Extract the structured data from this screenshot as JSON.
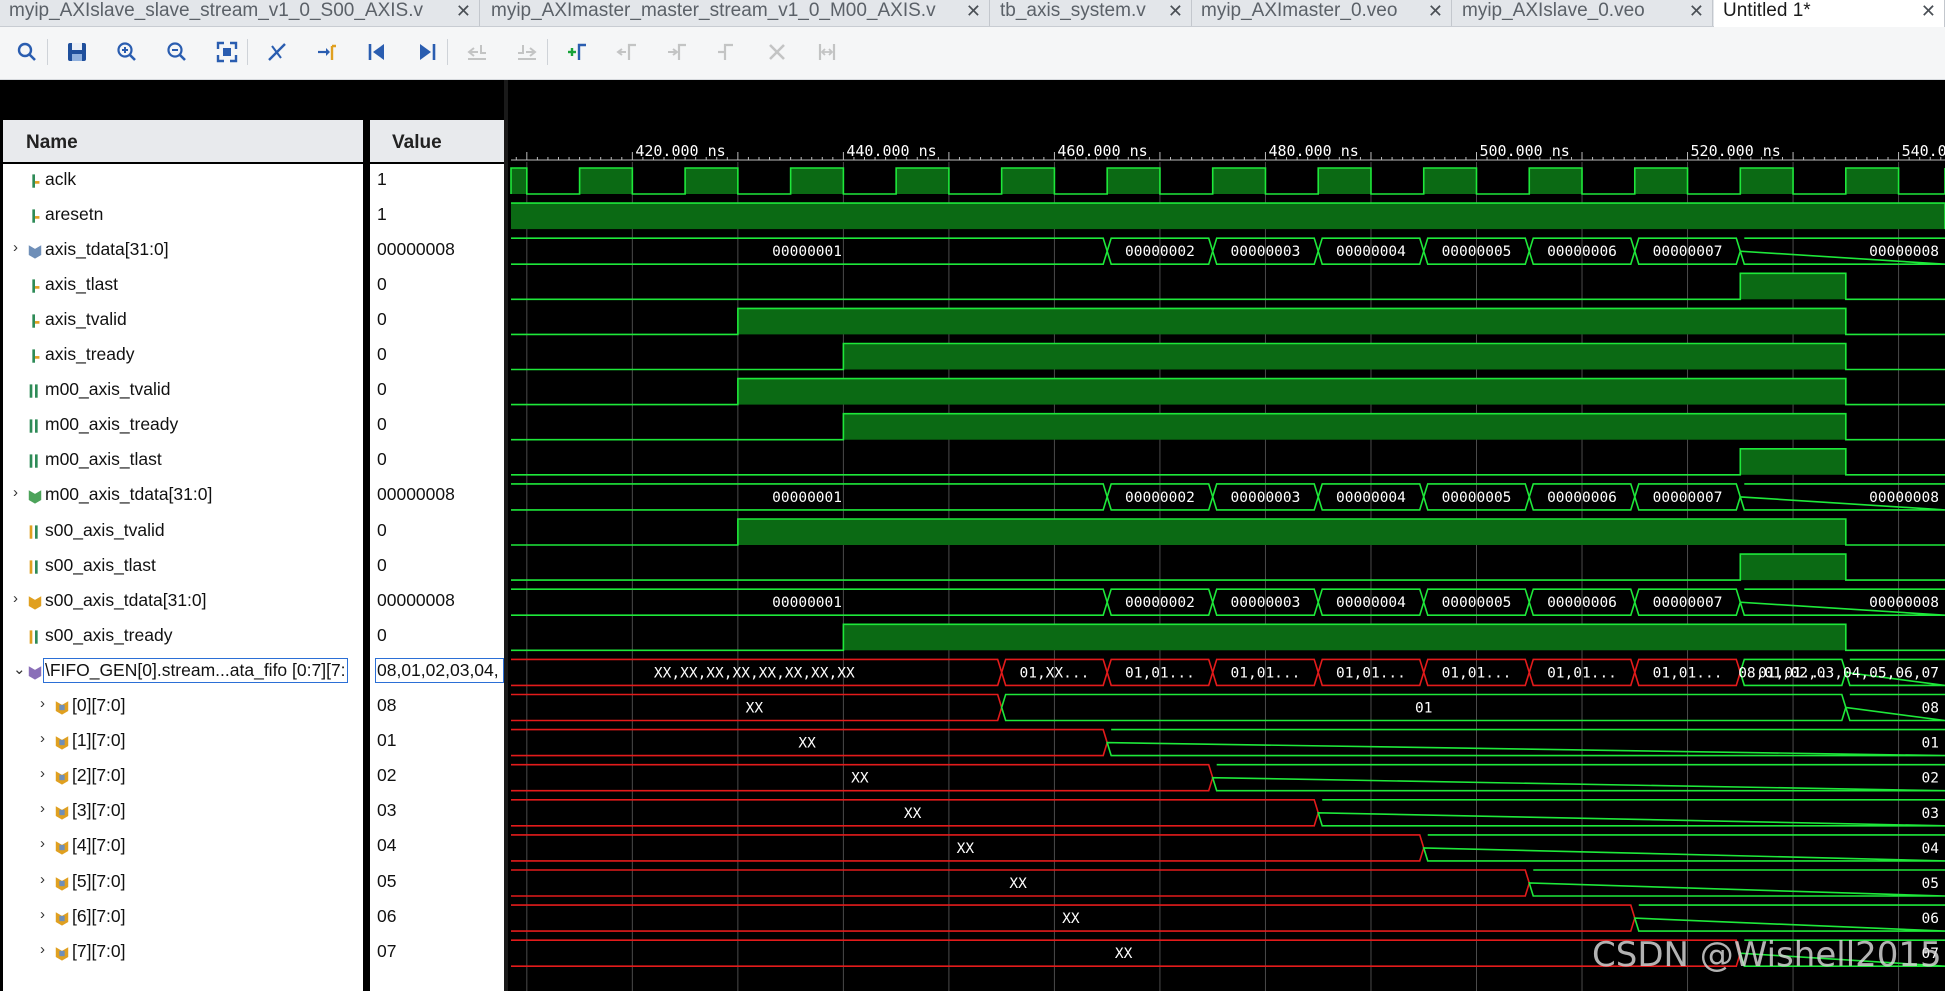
{
  "tabs": [
    {
      "label": "myip_AXIslave_slave_stream_v1_0_S00_AXIS.v",
      "active": false
    },
    {
      "label": "myip_AXImaster_master_stream_v1_0_M00_AXIS.v",
      "active": false
    },
    {
      "label": "tb_axis_system.v",
      "active": false
    },
    {
      "label": "myip_AXImaster_0.veo",
      "active": false
    },
    {
      "label": "myip_AXIslave_0.veo",
      "active": false
    },
    {
      "label": "Untitled 1*",
      "active": true
    }
  ],
  "toolbar": {
    "buttons": [
      {
        "name": "search-icon",
        "enabled": true
      },
      {
        "name": "save-icon",
        "enabled": true
      },
      {
        "name": "zoom-in-icon",
        "enabled": true
      },
      {
        "name": "zoom-out-icon",
        "enabled": true
      },
      {
        "name": "zoom-fit-icon",
        "enabled": true
      },
      {
        "name": "cursor-to-zero-icon",
        "enabled": true
      },
      {
        "name": "go-to-cursor-icon",
        "enabled": true
      },
      {
        "name": "go-to-start-icon",
        "enabled": true
      },
      {
        "name": "go-to-end-icon",
        "enabled": true
      },
      {
        "name": "previous-transition-icon",
        "enabled": false
      },
      {
        "name": "next-transition-icon",
        "enabled": false
      },
      {
        "name": "add-marker-icon",
        "enabled": true
      },
      {
        "name": "previous-marker-icon",
        "enabled": false
      },
      {
        "name": "next-marker-icon",
        "enabled": false
      },
      {
        "name": "swap-cursors-icon",
        "enabled": false
      },
      {
        "name": "delete-marker-icon",
        "enabled": false
      },
      {
        "name": "snap-to-transition-icon",
        "enabled": false
      }
    ]
  },
  "columns": {
    "name": "Name",
    "value": "Value"
  },
  "signals": [
    {
      "name": "aclk",
      "value": "1",
      "type": "bit",
      "icon": "input-bit-icon",
      "expander": ""
    },
    {
      "name": "aresetn",
      "value": "1",
      "type": "bit",
      "icon": "input-bit-icon",
      "expander": ""
    },
    {
      "name": "axis_tdata[31:0]",
      "value": "00000008",
      "type": "bus",
      "icon": "bus-icon",
      "expander": "›"
    },
    {
      "name": "axis_tlast",
      "value": "0",
      "type": "bit",
      "icon": "input-bit-icon",
      "expander": ""
    },
    {
      "name": "axis_tvalid",
      "value": "0",
      "type": "bit",
      "icon": "input-bit-icon",
      "expander": ""
    },
    {
      "name": "axis_tready",
      "value": "0",
      "type": "bit",
      "icon": "input-bit-icon",
      "expander": ""
    },
    {
      "name": "m00_axis_tvalid",
      "value": "0",
      "type": "bit",
      "icon": "output-bit-icon",
      "expander": ""
    },
    {
      "name": "m00_axis_tready",
      "value": "0",
      "type": "bit",
      "icon": "output-bit-icon",
      "expander": ""
    },
    {
      "name": "m00_axis_tlast",
      "value": "0",
      "type": "bit",
      "icon": "output-bit-icon",
      "expander": ""
    },
    {
      "name": "m00_axis_tdata[31:0]",
      "value": "00000008",
      "type": "bus",
      "icon": "output-bus-icon",
      "expander": "›"
    },
    {
      "name": "s00_axis_tvalid",
      "value": "0",
      "type": "bit",
      "icon": "internal-bit-icon",
      "expander": ""
    },
    {
      "name": "s00_axis_tlast",
      "value": "0",
      "type": "bit",
      "icon": "internal-bit-icon",
      "expander": ""
    },
    {
      "name": "s00_axis_tdata[31:0]",
      "value": "00000008",
      "type": "bus",
      "icon": "internal-bus-icon",
      "expander": "›"
    },
    {
      "name": "s00_axis_tready",
      "value": "0",
      "type": "bit",
      "icon": "internal-bit-icon",
      "expander": ""
    },
    {
      "name": "\\FIFO_GEN[0].stream...ata_fifo [0:7][7:",
      "value": "08,01,02,03,04,",
      "type": "array",
      "icon": "array-icon",
      "expander": "⌄",
      "selected": true
    },
    {
      "name": "[0][7:0]",
      "value": "08",
      "type": "bus",
      "icon": "array-bus-icon",
      "expander": "›",
      "indent": true
    },
    {
      "name": "[1][7:0]",
      "value": "01",
      "type": "bus",
      "icon": "array-bus-icon",
      "expander": "›",
      "indent": true
    },
    {
      "name": "[2][7:0]",
      "value": "02",
      "type": "bus",
      "icon": "array-bus-icon",
      "expander": "›",
      "indent": true
    },
    {
      "name": "[3][7:0]",
      "value": "03",
      "type": "bus",
      "icon": "array-bus-icon",
      "expander": "›",
      "indent": true
    },
    {
      "name": "[4][7:0]",
      "value": "04",
      "type": "bus",
      "icon": "array-bus-icon",
      "expander": "›",
      "indent": true
    },
    {
      "name": "[5][7:0]",
      "value": "05",
      "type": "bus",
      "icon": "array-bus-icon",
      "expander": "›",
      "indent": true
    },
    {
      "name": "[6][7:0]",
      "value": "06",
      "type": "bus",
      "icon": "array-bus-icon",
      "expander": "›",
      "indent": true
    },
    {
      "name": "[7][7:0]",
      "value": "07",
      "type": "bus",
      "icon": "array-bus-icon",
      "expander": "›",
      "indent": true
    }
  ],
  "timeline": {
    "unit": "ns",
    "view_start": 408.5,
    "view_end": 544.4,
    "tick_labels": [
      "420.000 ns",
      "440.000 ns",
      "460.000 ns",
      "480.000 ns",
      "500.000 ns",
      "520.000 ns",
      "540.000 ns"
    ],
    "tick_values": [
      420,
      440,
      460,
      480,
      500,
      520,
      540
    ],
    "clock_period": 10
  },
  "waveforms": [
    {
      "kind": "clock",
      "high_times": [
        [
          405,
          410
        ],
        [
          415,
          420
        ],
        [
          425,
          430
        ],
        [
          435,
          440
        ],
        [
          445,
          450
        ],
        [
          455,
          460
        ],
        [
          465,
          470
        ],
        [
          475,
          480
        ],
        [
          485,
          490
        ],
        [
          495,
          500
        ],
        [
          505,
          510
        ],
        [
          515,
          520
        ],
        [
          525,
          530
        ],
        [
          535,
          540
        ],
        [
          545,
          550
        ]
      ]
    },
    {
      "kind": "level",
      "start_value": 1,
      "edges": []
    },
    {
      "kind": "bus",
      "color": "green",
      "segments": [
        {
          "start": 400,
          "end": 465,
          "label": "00000001"
        },
        {
          "start": 465,
          "end": 475,
          "label": "00000002"
        },
        {
          "start": 475,
          "end": 485,
          "label": "00000003"
        },
        {
          "start": 485,
          "end": 495,
          "label": "00000004"
        },
        {
          "start": 495,
          "end": 505,
          "label": "00000005"
        },
        {
          "start": 505,
          "end": 515,
          "label": "00000006"
        },
        {
          "start": 515,
          "end": 525,
          "label": "00000007"
        },
        {
          "start": 525,
          "end": 600,
          "label": "00000008"
        }
      ]
    },
    {
      "kind": "level",
      "start_value": 0,
      "edges": [
        525,
        535
      ]
    },
    {
      "kind": "level",
      "start_value": 0,
      "edges": [
        430,
        535
      ]
    },
    {
      "kind": "level",
      "start_value": 0,
      "edges": [
        440,
        535
      ]
    },
    {
      "kind": "level",
      "start_value": 0,
      "edges": [
        430,
        535
      ]
    },
    {
      "kind": "level",
      "start_value": 0,
      "edges": [
        440,
        535
      ]
    },
    {
      "kind": "level",
      "start_value": 0,
      "edges": [
        525,
        535
      ]
    },
    {
      "kind": "bus",
      "color": "green",
      "segments": [
        {
          "start": 400,
          "end": 465,
          "label": "00000001"
        },
        {
          "start": 465,
          "end": 475,
          "label": "00000002"
        },
        {
          "start": 475,
          "end": 485,
          "label": "00000003"
        },
        {
          "start": 485,
          "end": 495,
          "label": "00000004"
        },
        {
          "start": 495,
          "end": 505,
          "label": "00000005"
        },
        {
          "start": 505,
          "end": 515,
          "label": "00000006"
        },
        {
          "start": 515,
          "end": 525,
          "label": "00000007"
        },
        {
          "start": 525,
          "end": 600,
          "label": "00000008"
        }
      ]
    },
    {
      "kind": "level",
      "start_value": 0,
      "edges": [
        430,
        535
      ]
    },
    {
      "kind": "level",
      "start_value": 0,
      "edges": [
        525,
        535
      ]
    },
    {
      "kind": "bus",
      "color": "green",
      "segments": [
        {
          "start": 400,
          "end": 465,
          "label": "00000001"
        },
        {
          "start": 465,
          "end": 475,
          "label": "00000002"
        },
        {
          "start": 475,
          "end": 485,
          "label": "00000003"
        },
        {
          "start": 485,
          "end": 495,
          "label": "00000004"
        },
        {
          "start": 495,
          "end": 505,
          "label": "00000005"
        },
        {
          "start": 505,
          "end": 515,
          "label": "00000006"
        },
        {
          "start": 515,
          "end": 525,
          "label": "00000007"
        },
        {
          "start": 525,
          "end": 600,
          "label": "00000008"
        }
      ]
    },
    {
      "kind": "level",
      "start_value": 0,
      "edges": [
        440,
        535
      ]
    },
    {
      "kind": "bus",
      "segments": [
        {
          "start": 400,
          "end": 455,
          "label": "XX,XX,XX,XX,XX,XX,XX,XX",
          "color": "red"
        },
        {
          "start": 455,
          "end": 465,
          "label": "01,XX...",
          "color": "red"
        },
        {
          "start": 465,
          "end": 475,
          "label": "01,01...",
          "color": "red"
        },
        {
          "start": 475,
          "end": 485,
          "label": "01,01...",
          "color": "red"
        },
        {
          "start": 485,
          "end": 495,
          "label": "01,01...",
          "color": "red"
        },
        {
          "start": 495,
          "end": 505,
          "label": "01,01...",
          "color": "red"
        },
        {
          "start": 505,
          "end": 515,
          "label": "01,01...",
          "color": "red"
        },
        {
          "start": 515,
          "end": 525,
          "label": "01,01...",
          "color": "red"
        },
        {
          "start": 525,
          "end": 535,
          "label": "01,01...",
          "color": "green"
        },
        {
          "start": 535,
          "end": 600,
          "label": "08,01,02,03,04,05,06,07",
          "color": "green"
        }
      ]
    },
    {
      "kind": "bus",
      "segments": [
        {
          "start": 400,
          "end": 455,
          "label": "XX",
          "color": "red"
        },
        {
          "start": 455,
          "end": 535,
          "label": "01",
          "color": "green"
        },
        {
          "start": 535,
          "end": 600,
          "label": "08",
          "color": "green"
        }
      ]
    },
    {
      "kind": "bus",
      "segments": [
        {
          "start": 400,
          "end": 465,
          "label": "XX",
          "color": "red"
        },
        {
          "start": 465,
          "end": 600,
          "label": "01",
          "color": "green"
        }
      ]
    },
    {
      "kind": "bus",
      "segments": [
        {
          "start": 400,
          "end": 475,
          "label": "XX",
          "color": "red"
        },
        {
          "start": 475,
          "end": 600,
          "label": "02",
          "color": "green"
        }
      ]
    },
    {
      "kind": "bus",
      "segments": [
        {
          "start": 400,
          "end": 485,
          "label": "XX",
          "color": "red"
        },
        {
          "start": 485,
          "end": 600,
          "label": "03",
          "color": "green"
        }
      ]
    },
    {
      "kind": "bus",
      "segments": [
        {
          "start": 400,
          "end": 495,
          "label": "XX",
          "color": "red"
        },
        {
          "start": 495,
          "end": 600,
          "label": "04",
          "color": "green"
        }
      ]
    },
    {
      "kind": "bus",
      "segments": [
        {
          "start": 400,
          "end": 505,
          "label": "XX",
          "color": "red"
        },
        {
          "start": 505,
          "end": 600,
          "label": "05",
          "color": "green"
        }
      ]
    },
    {
      "kind": "bus",
      "segments": [
        {
          "start": 400,
          "end": 515,
          "label": "XX",
          "color": "red"
        },
        {
          "start": 515,
          "end": 600,
          "label": "06",
          "color": "green"
        }
      ]
    },
    {
      "kind": "bus",
      "segments": [
        {
          "start": 400,
          "end": 525,
          "label": "XX",
          "color": "red"
        },
        {
          "start": 525,
          "end": 600,
          "label": "07",
          "color": "green"
        }
      ]
    }
  ],
  "colors": {
    "wave_green": "#1ee83a",
    "wave_fill": "#0b6a14",
    "wave_red": "#e31b1b",
    "grid": "#4a4a4a",
    "selection": "#2b6fd6"
  },
  "watermark": "CSDN @Wishell2015"
}
